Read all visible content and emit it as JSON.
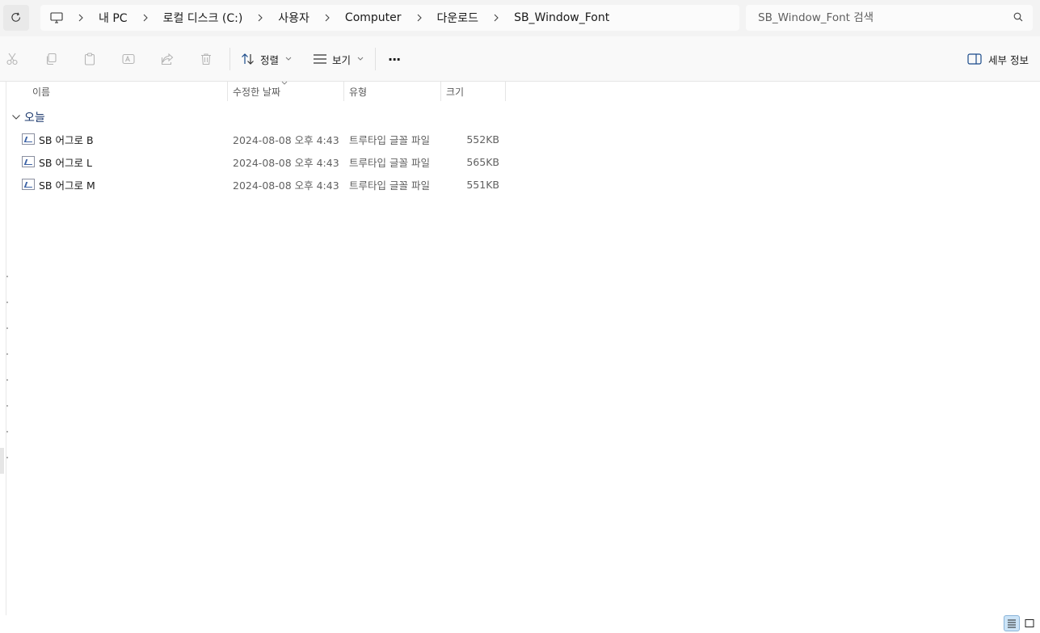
{
  "breadcrumb": {
    "items": [
      {
        "label": "내 PC"
      },
      {
        "label": "로컬 디스크 (C:)"
      },
      {
        "label": "사용자"
      },
      {
        "label": "Computer"
      },
      {
        "label": "다운로드"
      },
      {
        "label": "SB_Window_Font"
      }
    ]
  },
  "search": {
    "placeholder": "SB_Window_Font 검색"
  },
  "toolbar": {
    "sort_label": "정렬",
    "view_label": "보기",
    "more_label": "···",
    "details_label": "세부 정보"
  },
  "columns": {
    "name": "이름",
    "date": "수정한 날짜",
    "type": "유형",
    "size": "크기"
  },
  "group": {
    "label": "오늘"
  },
  "files": [
    {
      "name": "SB 어그로 B",
      "date": "2024-08-08 오후 4:43",
      "type": "트루타입 글꼴 파일",
      "size": "552KB"
    },
    {
      "name": "SB 어그로 L",
      "date": "2024-08-08 오후 4:43",
      "type": "트루타입 글꼴 파일",
      "size": "565KB"
    },
    {
      "name": "SB 어그로 M",
      "date": "2024-08-08 오후 4:43",
      "type": "트루타입 글꼴 파일",
      "size": "551KB"
    }
  ],
  "colors": {
    "accent": "#1d3a6e",
    "selected_view": "#cce4f7"
  }
}
